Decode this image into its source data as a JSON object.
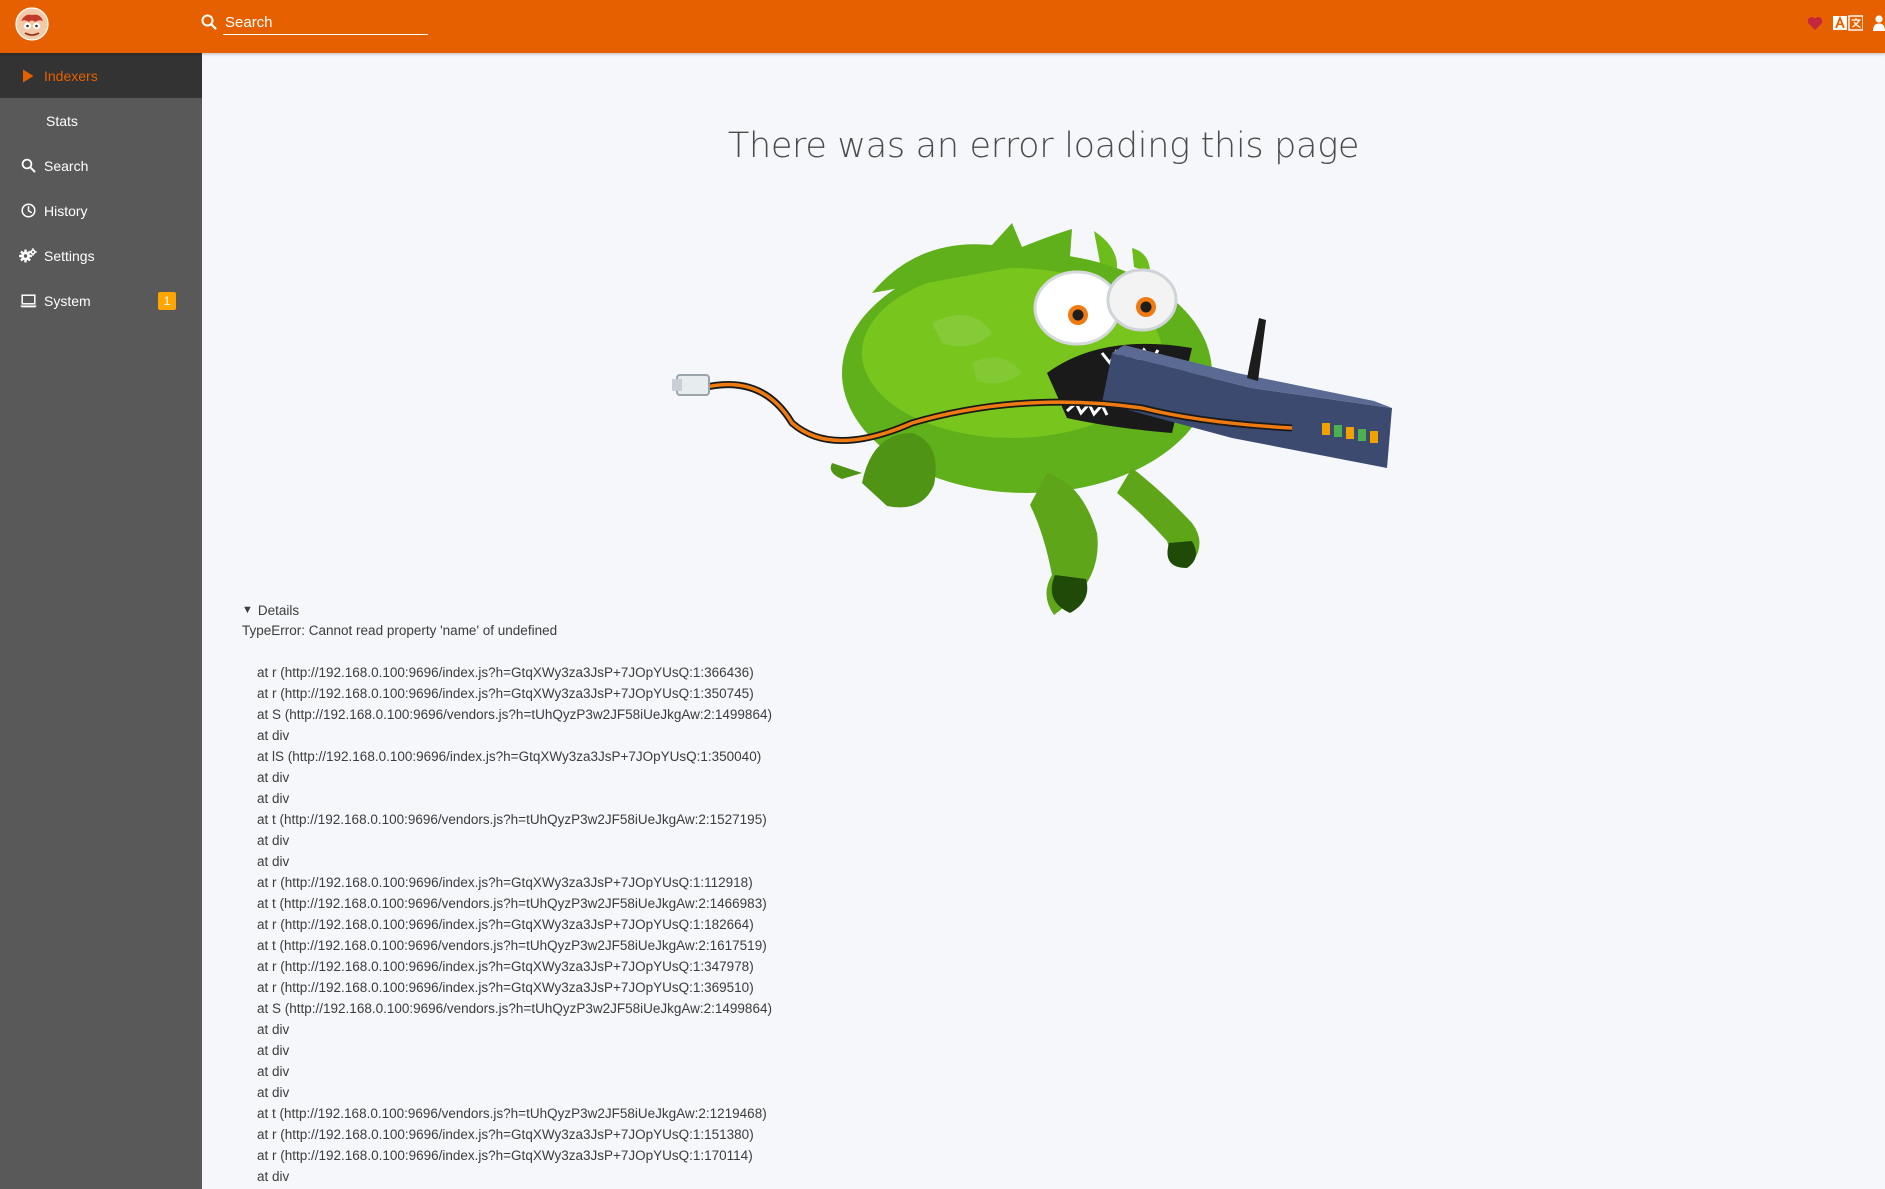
{
  "header": {
    "search_placeholder": "Search",
    "accent_color": "#e66000",
    "icons": [
      "logo-icon",
      "search-icon",
      "heart-icon",
      "translate-icon",
      "user-icon"
    ]
  },
  "sidebar": {
    "items": [
      {
        "label": "Indexers",
        "icon": "play-icon",
        "active": true
      },
      {
        "label": "Stats",
        "icon": "",
        "sub": true
      },
      {
        "label": "Search",
        "icon": "search-icon"
      },
      {
        "label": "History",
        "icon": "clock-icon"
      },
      {
        "label": "Settings",
        "icon": "gears-icon"
      },
      {
        "label": "System",
        "icon": "laptop-icon",
        "badge": "1"
      }
    ]
  },
  "main": {
    "title": "There was an error loading this page",
    "details": {
      "summary": "Details",
      "message": "TypeError: Cannot read property 'name' of undefined",
      "stack": [
        "at r (http://192.168.0.100:9696/index.js?h=GtqXWy3za3JsP+7JOpYUsQ:1:366436)",
        "at r (http://192.168.0.100:9696/index.js?h=GtqXWy3za3JsP+7JOpYUsQ:1:350745)",
        "at S (http://192.168.0.100:9696/vendors.js?h=tUhQyzP3w2JF58iUeJkgAw:2:1499864)",
        "at div",
        "at lS (http://192.168.0.100:9696/index.js?h=GtqXWy3za3JsP+7JOpYUsQ:1:350040)",
        "at div",
        "at div",
        "at t (http://192.168.0.100:9696/vendors.js?h=tUhQyzP3w2JF58iUeJkgAw:2:1527195)",
        "at div",
        "at div",
        "at r (http://192.168.0.100:9696/index.js?h=GtqXWy3za3JsP+7JOpYUsQ:1:112918)",
        "at t (http://192.168.0.100:9696/vendors.js?h=tUhQyzP3w2JF58iUeJkgAw:2:1466983)",
        "at r (http://192.168.0.100:9696/index.js?h=GtqXWy3za3JsP+7JOpYUsQ:1:182664)",
        "at t (http://192.168.0.100:9696/vendors.js?h=tUhQyzP3w2JF58iUeJkgAw:2:1617519)",
        "at r (http://192.168.0.100:9696/index.js?h=GtqXWy3za3JsP+7JOpYUsQ:1:347978)",
        "at r (http://192.168.0.100:9696/index.js?h=GtqXWy3za3JsP+7JOpYUsQ:1:369510)",
        "at S (http://192.168.0.100:9696/vendors.js?h=tUhQyzP3w2JF58iUeJkgAw:2:1499864)",
        "at div",
        "at div",
        "at div",
        "at div",
        "at t (http://192.168.0.100:9696/vendors.js?h=tUhQyzP3w2JF58iUeJkgAw:2:1219468)",
        "at r (http://192.168.0.100:9696/index.js?h=GtqXWy3za3JsP+7JOpYUsQ:1:151380)",
        "at r (http://192.168.0.100:9696/index.js?h=GtqXWy3za3JsP+7JOpYUsQ:1:170114)",
        "at div"
      ]
    }
  }
}
